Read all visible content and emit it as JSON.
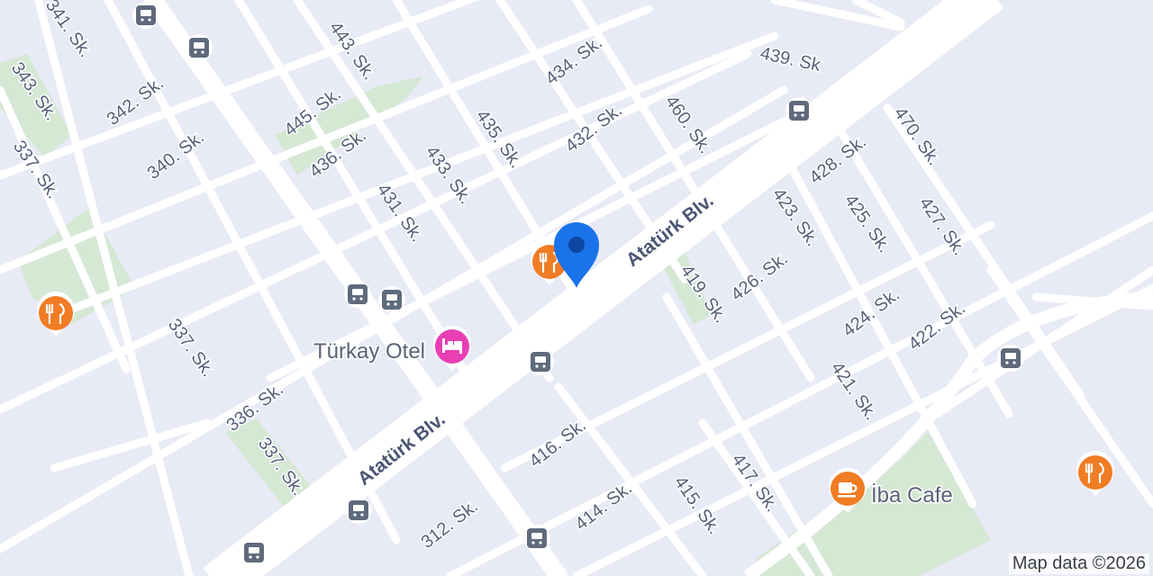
{
  "map": {
    "attribution": "Map data ©2026",
    "colors": {
      "background": "#e8eaf6",
      "road": "#ffffff",
      "park": "#d4e8d4",
      "transit": "#5f6b7c",
      "restaurant": "#f07c24",
      "hotel": "#e83fb5",
      "pin": "#1a73e8"
    },
    "streets": {
      "s341": "341. Sk.",
      "s343": "343. Sk.",
      "s342": "342. Sk.",
      "s337a": "337. Sk.",
      "s340": "340. Sk.",
      "s443": "443. Sk.",
      "s445": "445. Sk.",
      "s436": "436. Sk.",
      "s435": "435. Sk.",
      "s434": "434. Sk.",
      "s433": "433. Sk.",
      "s431": "431. Sk.",
      "s432": "432. Sk.",
      "s460": "460. Sk.",
      "s439": "439. Sk",
      "s470": "470. Sk.",
      "s428": "428. Sk.",
      "s423": "423. Sk.",
      "s425": "425. Sk.",
      "s427": "427. Sk.",
      "s419": "419. Sk.",
      "s426": "426. Sk.",
      "s424": "424. Sk.",
      "s422": "422. Sk.",
      "s421": "421. Sk.",
      "s337b": "337. Sk.",
      "s336": "336. Sk.",
      "s337c": "337. Sk.",
      "s416": "416. Sk.",
      "s312": "312. Sk.",
      "s414": "414. Sk.",
      "s415": "415. Sk.",
      "s417": "417. Sk.",
      "blvd1": "Atatürk Blv.",
      "blvd2": "Atatürk Blv."
    },
    "pois": {
      "hotel": {
        "label": "Türkay Otel",
        "icon": "hotel-bed-icon"
      },
      "cafe": {
        "label": "İba Cafe",
        "icon": "coffee-cup-icon"
      }
    },
    "pin": {
      "icon": "location-pin-icon"
    }
  }
}
